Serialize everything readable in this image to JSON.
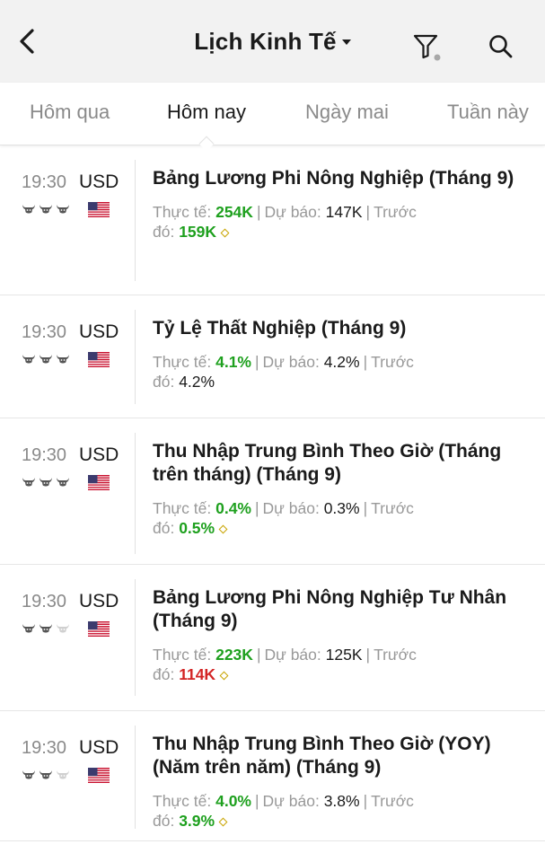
{
  "header": {
    "title": "Lịch Kinh Tế"
  },
  "tabs": [
    {
      "label": "Hôm qua",
      "active": false
    },
    {
      "label": "Hôm nay",
      "active": true
    },
    {
      "label": "Ngày mai",
      "active": false
    },
    {
      "label": "Tuần này",
      "active": false
    }
  ],
  "labels": {
    "actual": "Thực tế:",
    "forecast": "Dự báo:",
    "previous_a": "Trước",
    "previous_b": "đó:"
  },
  "colors": {
    "green": "#1ea01e",
    "red": "#d32424",
    "gray": "#999999"
  },
  "events": [
    {
      "time": "19:30",
      "currency": "USD",
      "importance": 3,
      "country": "us-flag-icon",
      "title": "Bảng Lương Phi Nông Nghiệp (Tháng 9)",
      "actual": "254K",
      "actual_tone": "green",
      "forecast": "147K",
      "previous": "159K",
      "previous_tone": "green",
      "revised": true
    },
    {
      "time": "19:30",
      "currency": "USD",
      "importance": 3,
      "country": "us-flag-icon",
      "title": "Tỷ Lệ Thất Nghiệp (Tháng 9)",
      "actual": "4.1%",
      "actual_tone": "green",
      "forecast": "4.2%",
      "previous": "4.2%",
      "previous_tone": "plain",
      "revised": false
    },
    {
      "time": "19:30",
      "currency": "USD",
      "importance": 3,
      "country": "us-flag-icon",
      "title": "Thu Nhập Trung Bình Theo Giờ (Tháng trên tháng) (Tháng 9)",
      "actual": "0.4%",
      "actual_tone": "green",
      "forecast": "0.3%",
      "previous": "0.5%",
      "previous_tone": "green",
      "revised": true
    },
    {
      "time": "19:30",
      "currency": "USD",
      "importance": 2,
      "country": "us-flag-icon",
      "title": "Bảng Lương Phi Nông Nghiệp Tư Nhân (Tháng 9)",
      "actual": "223K",
      "actual_tone": "green",
      "forecast": "125K",
      "previous": "114K",
      "previous_tone": "red",
      "revised": true
    },
    {
      "time": "19:30",
      "currency": "USD",
      "importance": 2,
      "country": "us-flag-icon",
      "title": "Thu Nhập Trung Bình Theo Giờ (YOY) (Năm trên năm) (Tháng 9)",
      "actual": "4.0%",
      "actual_tone": "green",
      "forecast": "3.8%",
      "previous": "3.9%",
      "previous_tone": "green",
      "revised": true
    }
  ]
}
